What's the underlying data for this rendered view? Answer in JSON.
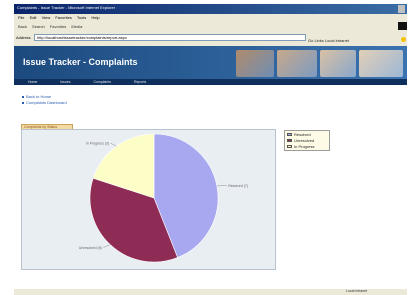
{
  "browser": {
    "title": "Complaints - Issue Tracker - Microsoft Internet Explorer",
    "menu": [
      "File",
      "Edit",
      "View",
      "Favorites",
      "Tools",
      "Help"
    ],
    "toolbar": [
      "Back",
      "Search",
      "Favorites",
      "Media"
    ],
    "address_label": "Address",
    "address_value": "http://localhost/issuetracker/complaints/report.aspx",
    "links_text": "Go   Links   Local intranet",
    "status_text": "Local intranet"
  },
  "app": {
    "title": "Issue Tracker - Complaints",
    "nav": [
      "Home",
      "Issues",
      "Complaints",
      "Reports"
    ]
  },
  "breadcrumbs": [
    "Back to Home",
    "Complaints Dashboard"
  ],
  "chart_tab_label": "Complaints by Status",
  "colors": {
    "resolved": "#a7a8ef",
    "unresolved": "#8e2c55",
    "in_progress": "#fdfdc8"
  },
  "chart_data": {
    "type": "pie",
    "slices": [
      {
        "name": "Resolved",
        "value": 44,
        "label": "Resolved (7)"
      },
      {
        "name": "Unresolved",
        "value": 36,
        "label": "Unresolved (6)"
      },
      {
        "name": "In Progress",
        "value": 20,
        "label": "In Progress (3)"
      }
    ],
    "legend_placement": "right"
  }
}
